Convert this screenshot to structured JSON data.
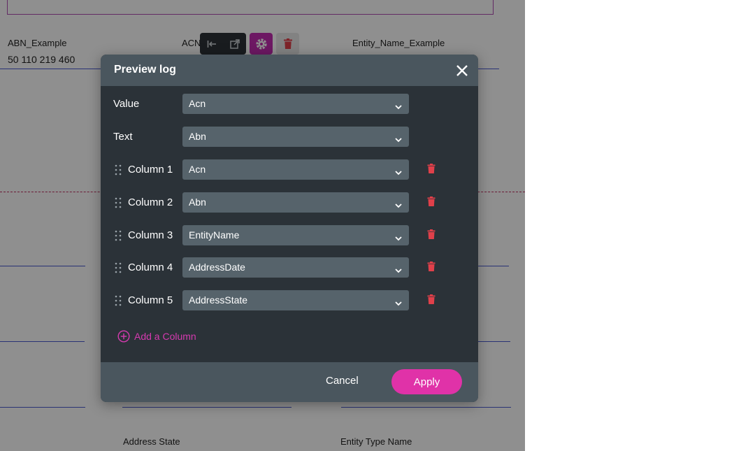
{
  "background": {
    "fields": {
      "abn_label": "ABN_Example",
      "abn_value": "50 110 219 460",
      "acn_label": "ACN",
      "entity_name_label": "Entity_Name_Example",
      "address_state_label": "Address State",
      "entity_type_label": "Entity Type Name"
    },
    "toolbar": {
      "icons": [
        "move-to-start-icon",
        "open-external-icon",
        "gear-icon",
        "trash-icon"
      ]
    }
  },
  "dialog": {
    "title": "Preview log",
    "rows": [
      {
        "label": "Value",
        "selected": "Acn",
        "draggable": false,
        "deletable": false
      },
      {
        "label": "Text",
        "selected": "Abn",
        "draggable": false,
        "deletable": false
      },
      {
        "label": "Column 1",
        "selected": "Acn",
        "draggable": true,
        "deletable": true
      },
      {
        "label": "Column 2",
        "selected": "Abn",
        "draggable": true,
        "deletable": true
      },
      {
        "label": "Column 3",
        "selected": "EntityName",
        "draggable": true,
        "deletable": true
      },
      {
        "label": "Column 4",
        "selected": "AddressDate",
        "draggable": true,
        "deletable": true
      },
      {
        "label": "Column 5",
        "selected": "AddressState",
        "draggable": true,
        "deletable": true
      }
    ],
    "add_column_label": "Add a Column",
    "cancel_label": "Cancel",
    "apply_label": "Apply"
  },
  "colors": {
    "accent": "#e032a8",
    "dialog_bg": "#2b3238",
    "header_bg": "#4a565e",
    "select_bg": "#56636b",
    "delete_red": "#e0404a"
  }
}
